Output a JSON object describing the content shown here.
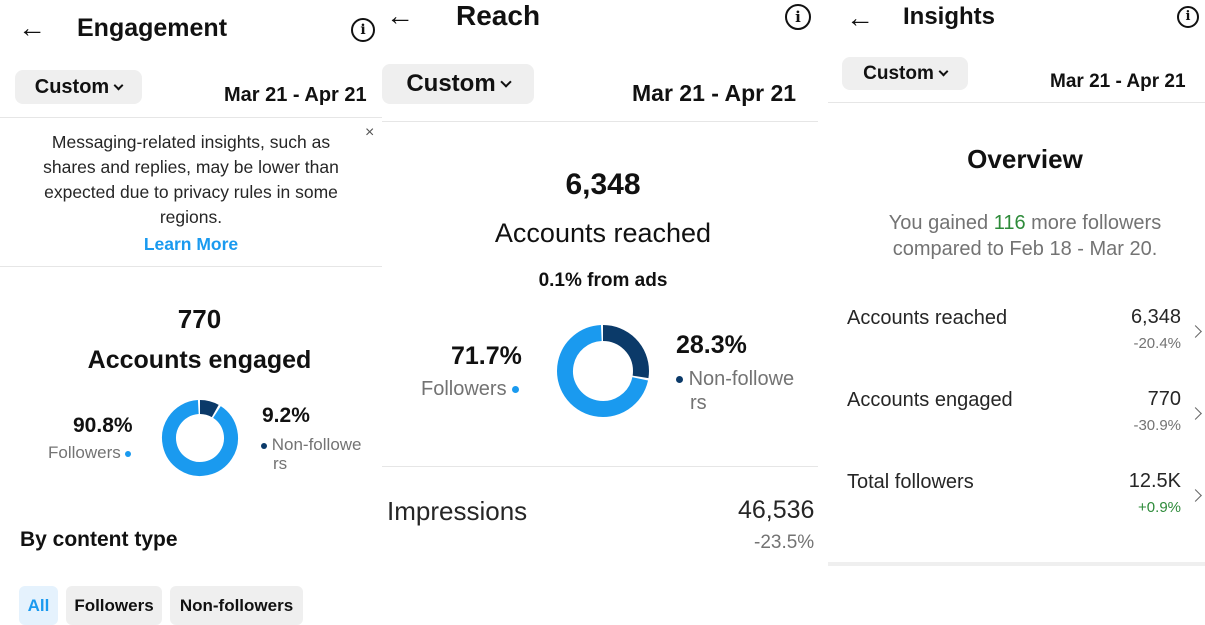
{
  "engagement": {
    "title": "Engagement",
    "date_filter": "Custom",
    "date_range": "Mar 21 - Apr 21",
    "notice": {
      "lines": [
        "Messaging-related insights, such as",
        "shares and replies, may be lower than",
        "expected due to privacy rules in some",
        "regions."
      ],
      "link": "Learn More",
      "close": "×"
    },
    "value": "770",
    "label": "Accounts engaged",
    "followers_pct": "90.8%",
    "followers_label": "Followers",
    "nonfollowers_pct": "9.2%",
    "nonfollowers_label_1": "Non-followe",
    "nonfollowers_label_2": "rs",
    "followers_fraction": 0.908,
    "section_title": "By content type",
    "chips": [
      "All",
      "Followers",
      "Non-followers"
    ]
  },
  "reach": {
    "title": "Reach",
    "date_filter": "Custom",
    "date_range": "Mar 21 - Apr 21",
    "value": "6,348",
    "label": "Accounts reached",
    "ads": "0.1% from ads",
    "followers_pct": "71.7%",
    "followers_label": "Followers",
    "nonfollowers_pct": "28.3%",
    "nonfollowers_label_1": "Non-followe",
    "nonfollowers_label_2": "rs",
    "followers_fraction": 0.717,
    "impressions_label": "Impressions",
    "impressions_value": "46,536",
    "impressions_change": "-23.5%"
  },
  "insights": {
    "title": "Insights",
    "date_filter": "Custom",
    "date_range": "Mar 21 - Apr 21",
    "overview_title": "Overview",
    "gained_prefix": "You gained ",
    "gained_value": "116",
    "gained_suffix": " more followers",
    "gained_line2": "compared to Feb 18 - Mar 20.",
    "rows": [
      {
        "label": "Accounts reached",
        "value": "6,348",
        "change": "-20.4%"
      },
      {
        "label": "Accounts engaged",
        "value": "770",
        "change": "-30.9%"
      },
      {
        "label": "Total followers",
        "value": "12.5K",
        "change": "+0.9%"
      }
    ]
  },
  "colors": {
    "followers": "#1a9aef",
    "nonfollowers": "#0b3a69",
    "link": "#1a9aef",
    "positive": "#2e8b3a",
    "chip_active_bg": "#e5f2fd",
    "chip_bg": "#efefef"
  },
  "icons": [
    "back-arrow-icon",
    "info-icon",
    "chevron-down-icon",
    "close-icon",
    "chevron-right-icon"
  ]
}
